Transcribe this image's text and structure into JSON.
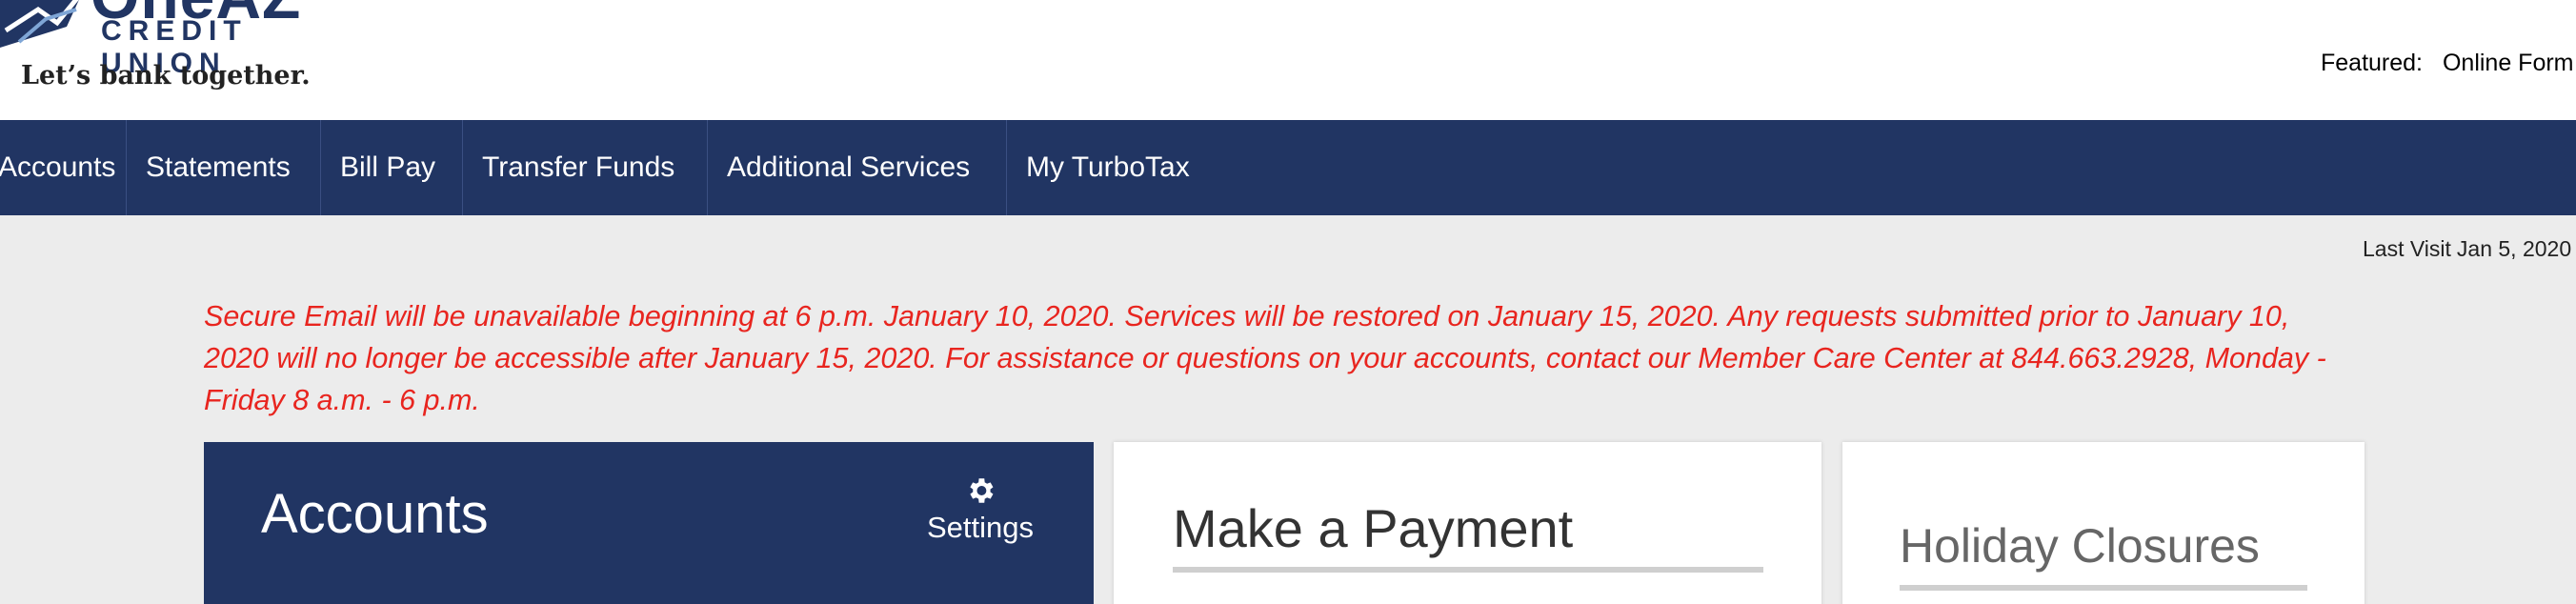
{
  "brand": {
    "name": "OneAZ",
    "sub": "CREDIT UNION",
    "tagline": "Let’s bank together."
  },
  "featured": {
    "label": "Featured:",
    "link": "Online Form"
  },
  "nav": {
    "items": [
      {
        "label": "Accounts"
      },
      {
        "label": "Statements"
      },
      {
        "label": "Bill Pay"
      },
      {
        "label": "Transfer Funds"
      },
      {
        "label": "Additional Services"
      },
      {
        "label": "My TurboTax"
      }
    ]
  },
  "last_visit": {
    "label": "Last Visit",
    "date": "Jan 5, 2020"
  },
  "alert": {
    "text": "Secure Email will be unavailable beginning at 6 p.m. January 10, 2020. Services will be restored on January 15, 2020. Any requests submitted prior to January 10, 2020 will no longer be accessible after January 15, 2020. For assistance or questions on your accounts, contact our Member Care Center at 844.663.2928, Monday - Friday 8 a.m. - 6 p.m."
  },
  "accounts_card": {
    "title": "Accounts",
    "settings_label": "Settings",
    "settings_icon": "gear-icon"
  },
  "payment_card": {
    "title": "Make a Payment"
  },
  "holiday_card": {
    "title": "Holiday Closures"
  },
  "colors": {
    "brand_navy": "#213563",
    "alert_red": "#e8251f",
    "background": "#ececec"
  }
}
